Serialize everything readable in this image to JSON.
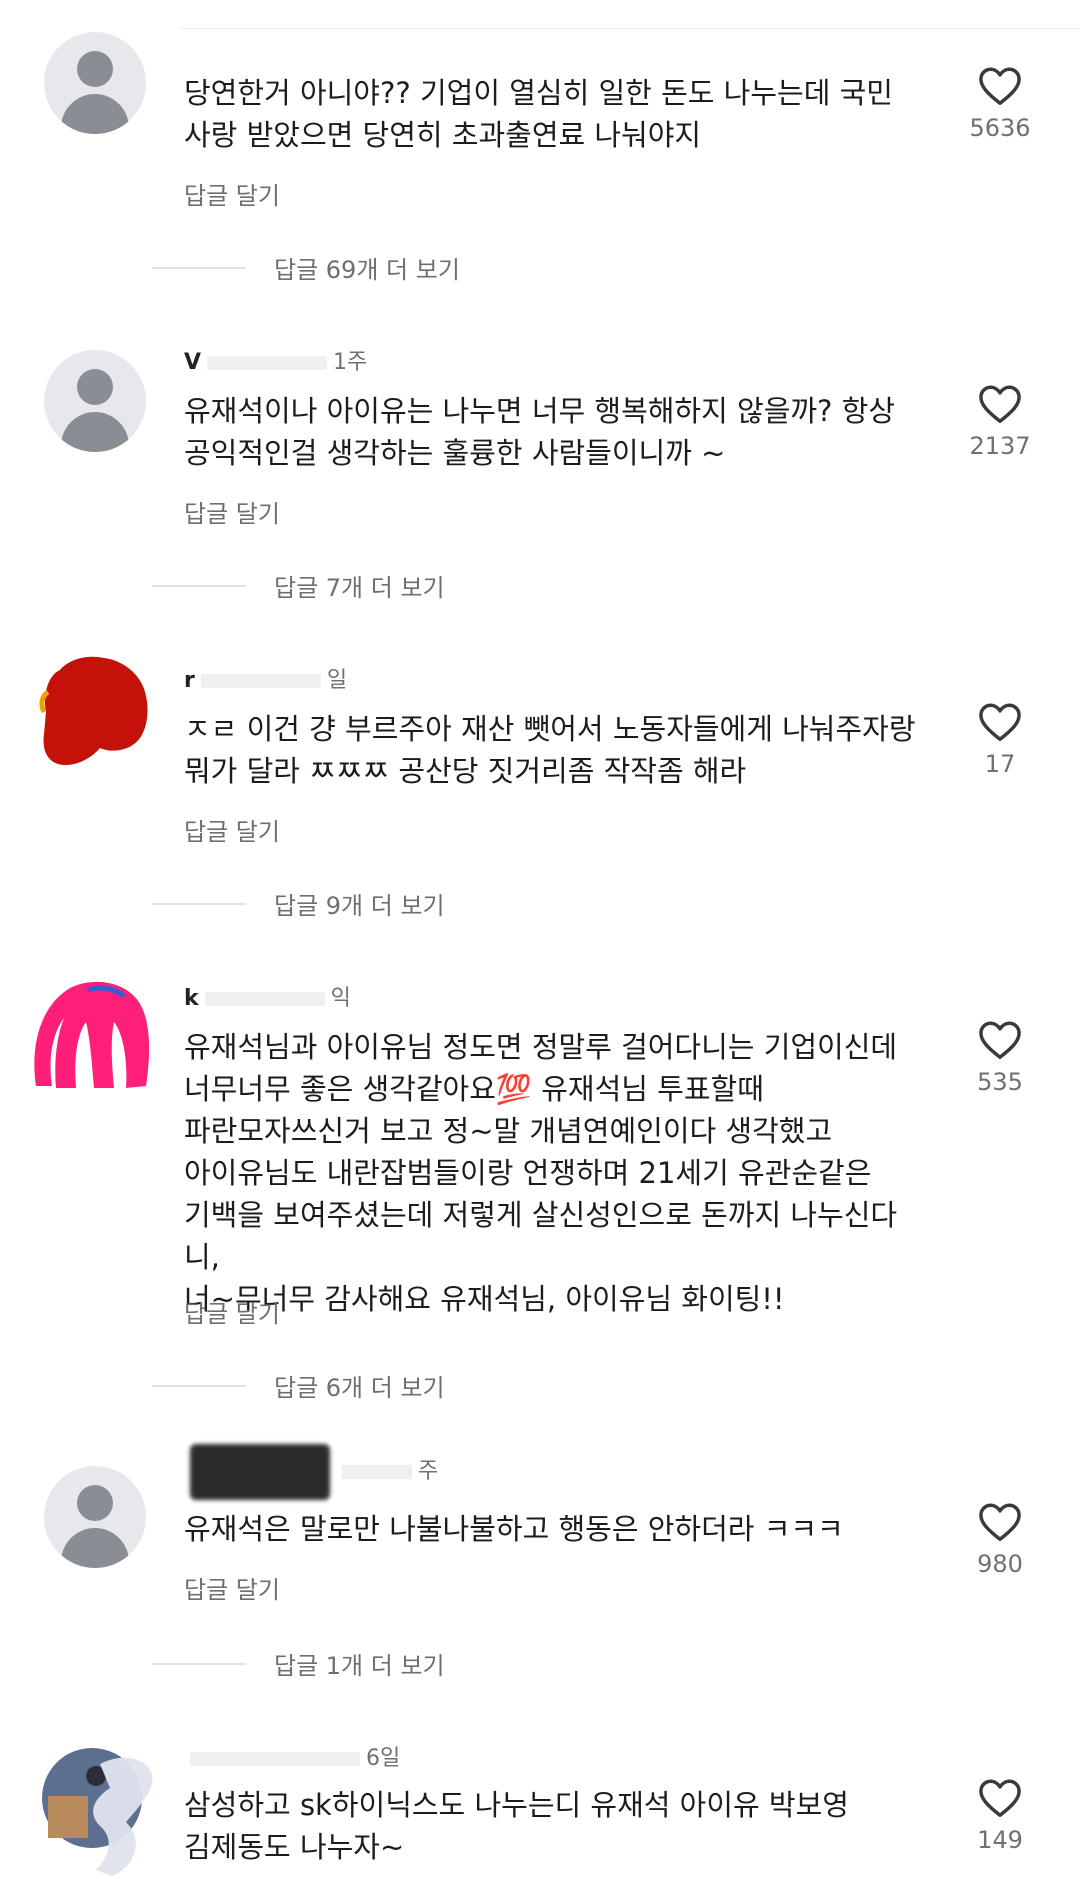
{
  "comments": [
    {
      "username": "",
      "age": "",
      "text": "당연한거 아니야?? 기업이 열심히 일한 돈도 나누는데 국민\n사랑 받았으면 당연히 초과출연료 나눠야지",
      "reply_label": "답글 달기",
      "likes": "5636",
      "more_replies": "답글 69개 더 보기",
      "avatar": "default-avatar"
    },
    {
      "username": "V",
      "age": "1주",
      "text": "유재석이나 아이유는 나누면 너무 행복해하지 않을까? 항상\n공익적인걸 생각하는 훌륭한 사람들이니까 ~",
      "reply_label": "답글 달기",
      "likes": "2137",
      "more_replies": "답글 7개 더 보기",
      "avatar": "default-avatar"
    },
    {
      "username": "r",
      "age": "일",
      "text": "ㅈㄹ 이건 걍 부르주아 재산 뺏어서 노동자들에게 나눠주자랑\n뭐가 달라 ㅉㅉㅉ 공산당 짓거리좀 작작좀 해라",
      "reply_label": "답글 달기",
      "likes": "17",
      "more_replies": "답글 9개 더 보기",
      "avatar": "red-avatar"
    },
    {
      "username": "k",
      "age": "익",
      "text": "유재석님과 아이유님 정도면 정말루 걸어다니는 기업이신데\n너무너무 좋은 생각같아요💯 유재석님 투표할때\n파란모자쓰신거 보고 정~말 개념연예인이다 생각했고\n아이유님도 내란잡범들이랑 언쟁하며 21세기 유관순같은\n기백을 보여주셨는데 저렇게 살신성인으로 돈까지 나누신다니,\n너~무너무 감사해요 유재석님, 아이유님 화이팅!!",
      "reply_label": "답글 달기",
      "likes": "535",
      "more_replies": "답글 6개 더 보기",
      "avatar": "pink-avatar"
    },
    {
      "username": "",
      "age": "주",
      "text": "유재석은 말로만 나불나불하고 행동은 안하더라 ㅋㅋㅋ",
      "reply_label": "답글 달기",
      "likes": "980",
      "more_replies": "답글 1개 더 보기",
      "avatar": "default-avatar"
    },
    {
      "username": "",
      "age": "6일",
      "text": "삼성하고 sk하이닉스도 나누는디 유재석 아이유 박보영\n김제동도 나누자~",
      "reply_label": "",
      "likes": "149",
      "more_replies": "",
      "avatar": "photo-avatar"
    }
  ],
  "icons": {
    "like": "heart-outline-icon"
  },
  "colors": {
    "text": "#1c1c1c",
    "secondary": "#707070",
    "avatar_bg": "#e7e8ec"
  }
}
